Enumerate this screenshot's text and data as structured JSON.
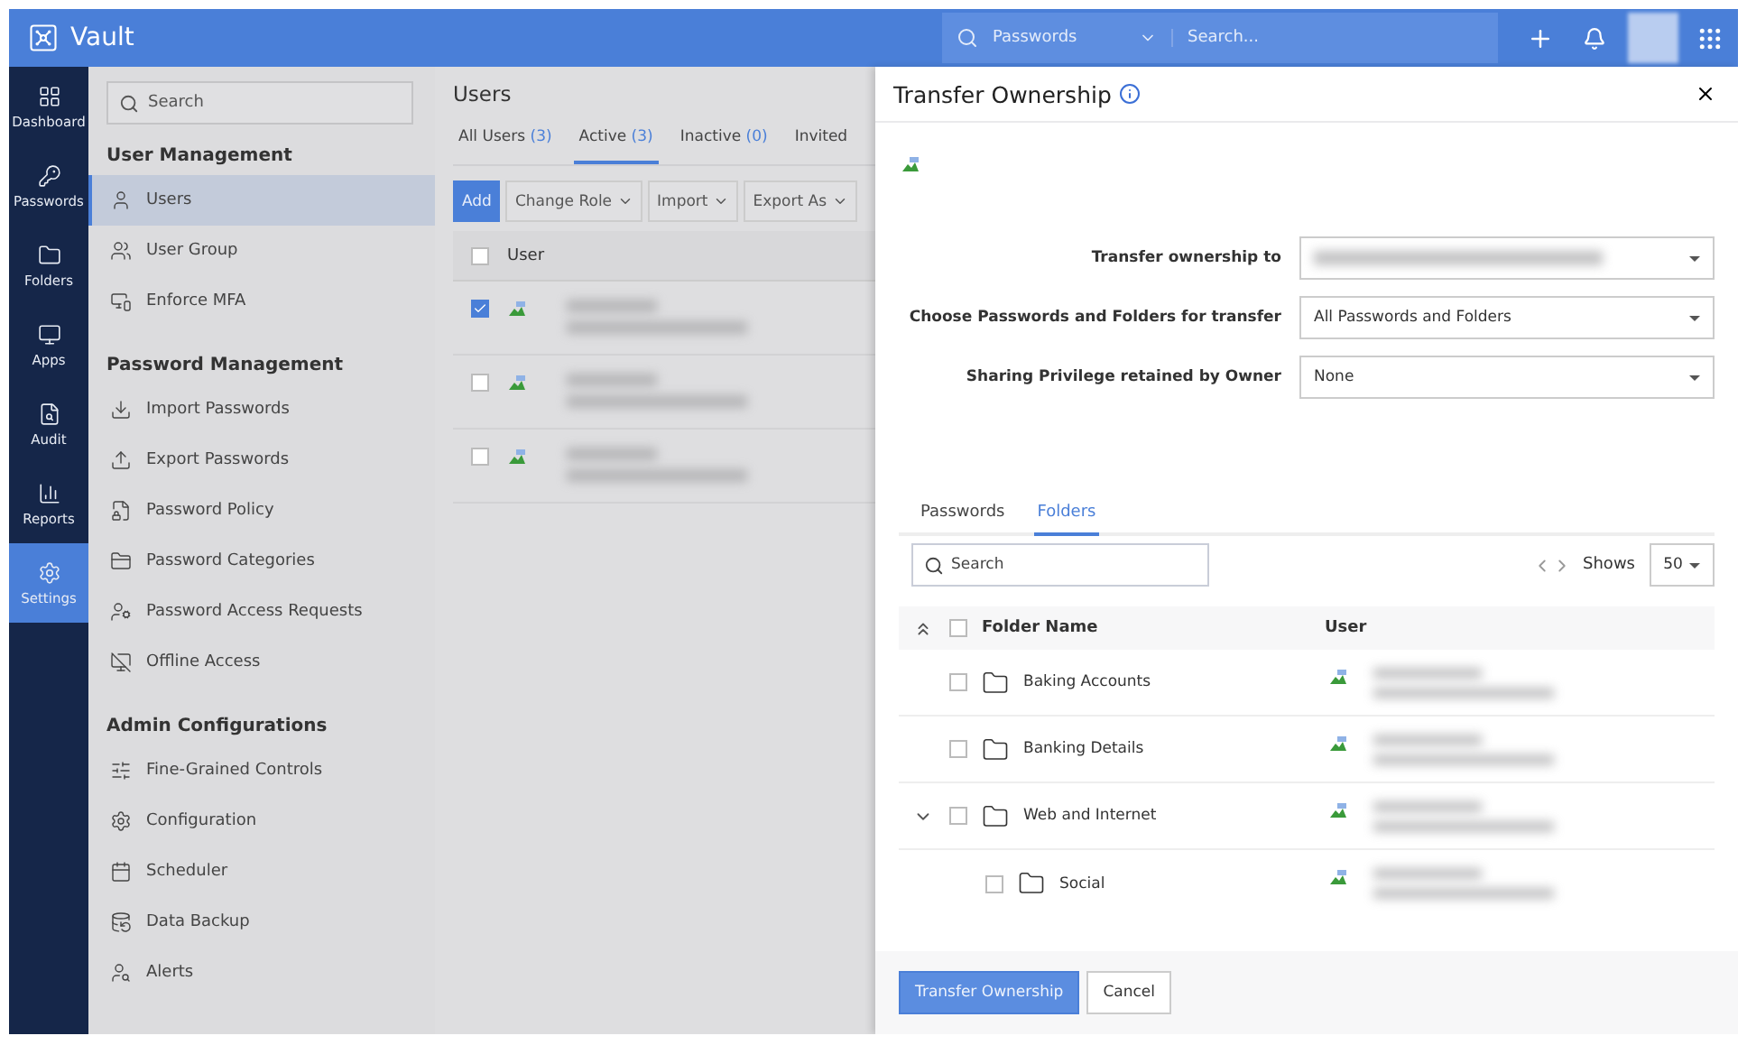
{
  "header": {
    "app_name": "Vault",
    "scope": "Passwords",
    "search_placeholder": "Search..."
  },
  "rail": [
    {
      "label": "Dashboard",
      "selected": false
    },
    {
      "label": "Passwords",
      "selected": false
    },
    {
      "label": "Folders",
      "selected": false
    },
    {
      "label": "Apps",
      "selected": false
    },
    {
      "label": "Audit",
      "selected": false
    },
    {
      "label": "Reports",
      "selected": false
    },
    {
      "label": "Settings",
      "selected": true
    }
  ],
  "settings_nav": {
    "search_placeholder": "Search",
    "sections": [
      {
        "title": "User Management",
        "items": [
          {
            "label": "Users",
            "selected": true
          },
          {
            "label": "User Group",
            "selected": false
          },
          {
            "label": "Enforce MFA",
            "selected": false
          }
        ]
      },
      {
        "title": "Password Management",
        "items": [
          {
            "label": "Import Passwords",
            "selected": false
          },
          {
            "label": "Export Passwords",
            "selected": false
          },
          {
            "label": "Password Policy",
            "selected": false
          },
          {
            "label": "Password Categories",
            "selected": false
          },
          {
            "label": "Password Access Requests",
            "selected": false
          },
          {
            "label": "Offline Access",
            "selected": false
          }
        ]
      },
      {
        "title": "Admin Configurations",
        "items": [
          {
            "label": "Fine-Grained Controls",
            "selected": false
          },
          {
            "label": "Configuration",
            "selected": false
          },
          {
            "label": "Scheduler",
            "selected": false
          },
          {
            "label": "Data Backup",
            "selected": false
          },
          {
            "label": "Alerts",
            "selected": false
          }
        ]
      }
    ]
  },
  "users": {
    "title": "Users",
    "tabs": [
      {
        "label": "All Users",
        "count": "(3)",
        "selected": false
      },
      {
        "label": "Active",
        "count": "(3)",
        "selected": true
      },
      {
        "label": "Inactive",
        "count": "(0)",
        "selected": false
      },
      {
        "label": "Invited",
        "selected": false
      }
    ],
    "toolbar": [
      {
        "label": "Add",
        "kind": "primary"
      },
      {
        "label": "Change Role",
        "kind": "menu"
      },
      {
        "label": "Import",
        "kind": "menu"
      },
      {
        "label": "Export As",
        "kind": "menu"
      }
    ],
    "column": "User",
    "all_checked": false,
    "rows": [
      {
        "checked": true
      },
      {
        "checked": false
      },
      {
        "checked": false
      }
    ]
  },
  "drawer": {
    "title": "Transfer Ownership",
    "fields": [
      {
        "label": "Transfer ownership to",
        "kind": "blurred"
      },
      {
        "label": "Choose Passwords and Folders for transfer",
        "kind": "text",
        "value": "All Passwords and Folders"
      },
      {
        "label": "Sharing Privilege retained by Owner",
        "kind": "text",
        "value": "None"
      }
    ],
    "tabs": [
      {
        "label": "Passwords",
        "selected": false
      },
      {
        "label": "Folders",
        "selected": true
      }
    ],
    "search_placeholder": "Search",
    "shows_label": "Shows",
    "page_size": "50",
    "columns": [
      "Folder Name",
      "User"
    ],
    "all_checked": false,
    "folders": [
      {
        "name": "Baking Accounts",
        "checked": false
      },
      {
        "name": "Banking Details",
        "checked": false
      },
      {
        "name": "Web and Internet",
        "checked": false,
        "expanded": true,
        "children": [
          {
            "name": "Social",
            "checked": false
          }
        ]
      }
    ],
    "buttons": [
      {
        "label": "Transfer Ownership",
        "kind": "primary"
      },
      {
        "label": "Cancel",
        "kind": "secondary"
      }
    ]
  }
}
